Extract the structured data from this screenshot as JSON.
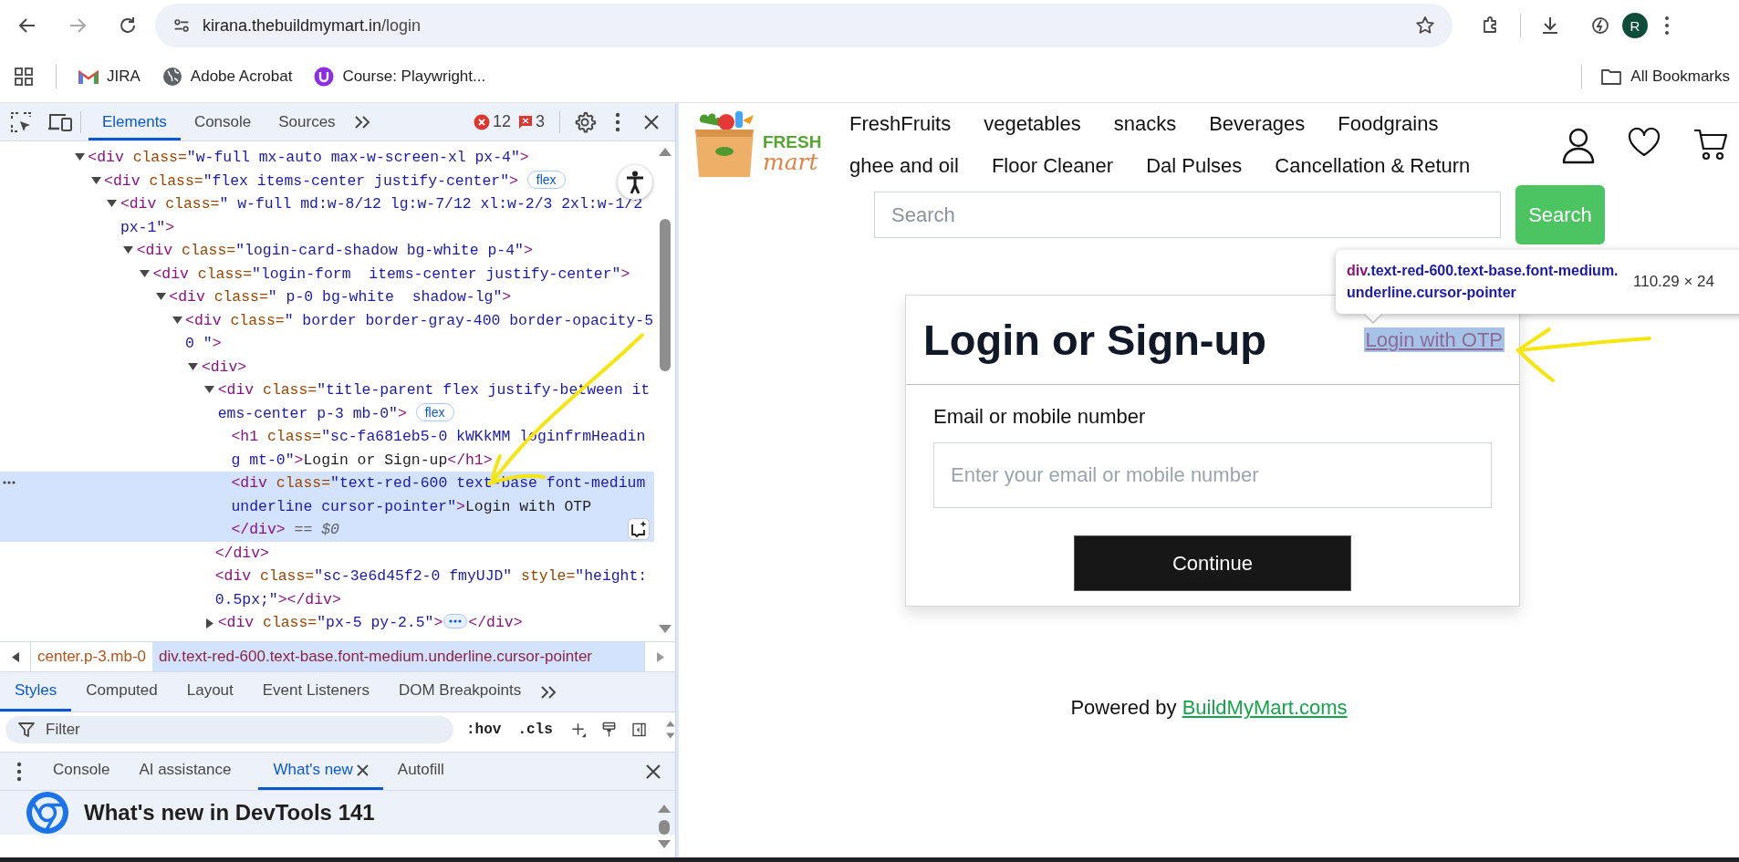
{
  "browser": {
    "url_host": "kirana.thebuildmymart.in",
    "url_path": "/login",
    "avatar": "R"
  },
  "bookmarks": [
    {
      "kind": "gmail",
      "label": "JIRA"
    },
    {
      "kind": "globe",
      "label": "Adobe Acrobat"
    },
    {
      "kind": "course",
      "label": "Course: Playwright..."
    }
  ],
  "all_bookmarks": "All Bookmarks",
  "devtools": {
    "tabs": [
      {
        "label": "Elements",
        "selected": true
      },
      {
        "label": "Console",
        "selected": false
      },
      {
        "label": "Sources",
        "selected": false
      }
    ],
    "errors": "12",
    "issues": "3",
    "dom_tree": [
      {
        "kind": "parent",
        "expanded": true,
        "selected": false,
        "tokens": [
          {
            "kind": "tag",
            "text": "<div"
          },
          {
            "kind": "attr",
            "text": " class="
          },
          {
            "kind": "value",
            "text": "\"w-full mx-auto max-w-screen-xl px-4\""
          },
          {
            "kind": "tag",
            "text": ">"
          }
        ],
        "children": [
          {
            "kind": "parent",
            "expanded": true,
            "selected": false,
            "badge": "flex",
            "tokens": [
              {
                "kind": "tag",
                "text": "<div"
              },
              {
                "kind": "attr",
                "text": " class="
              },
              {
                "kind": "value",
                "text": "\"flex items-center justify-center\""
              },
              {
                "kind": "tag",
                "text": ">"
              }
            ],
            "children": [
              {
                "kind": "parent",
                "expanded": true,
                "selected": false,
                "tokens": [
                  {
                    "kind": "tag",
                    "text": "<div"
                  },
                  {
                    "kind": "attr",
                    "text": " class="
                  },
                  {
                    "kind": "value",
                    "text": "\" w-full md:w-8/12 lg:w-7/12 xl:w-2/3 2xl:w-1/2 px-1\""
                  },
                  {
                    "kind": "tag",
                    "text": ">"
                  }
                ],
                "children": [
                  {
                    "kind": "parent",
                    "expanded": true,
                    "selected": false,
                    "tokens": [
                      {
                        "kind": "tag",
                        "text": "<div"
                      },
                      {
                        "kind": "attr",
                        "text": " class="
                      },
                      {
                        "kind": "value",
                        "text": "\"login-card-shadow bg-white p-4\""
                      },
                      {
                        "kind": "tag",
                        "text": ">"
                      }
                    ],
                    "children": [
                      {
                        "kind": "parent",
                        "expanded": true,
                        "selected": false,
                        "tokens": [
                          {
                            "kind": "tag",
                            "text": "<div"
                          },
                          {
                            "kind": "attr",
                            "text": " class="
                          },
                          {
                            "kind": "value",
                            "text": "\"login-form  items-center justify-center\""
                          },
                          {
                            "kind": "tag",
                            "text": ">"
                          }
                        ],
                        "children": [
                          {
                            "kind": "parent",
                            "expanded": true,
                            "selected": false,
                            "tokens": [
                              {
                                "kind": "tag",
                                "text": "<div"
                              },
                              {
                                "kind": "attr",
                                "text": " class="
                              },
                              {
                                "kind": "value",
                                "text": "\" p-0 bg-white  shadow-lg\""
                              },
                              {
                                "kind": "tag",
                                "text": ">"
                              }
                            ],
                            "children": [
                              {
                                "kind": "parent",
                                "expanded": true,
                                "selected": false,
                                "tokens": [
                                  {
                                    "kind": "tag",
                                    "text": "<div"
                                  },
                                  {
                                    "kind": "attr",
                                    "text": " class="
                                  },
                                  {
                                    "kind": "value",
                                    "text": "\" border border-gray-400 border-opacity-50 \""
                                  },
                                  {
                                    "kind": "tag",
                                    "text": ">"
                                  }
                                ],
                                "children": [
                                  {
                                    "kind": "parent",
                                    "expanded": true,
                                    "selected": false,
                                    "tokens": [
                                      {
                                        "kind": "tag",
                                        "text": "<div>"
                                      }
                                    ],
                                    "children": [
                                      {
                                        "kind": "parent",
                                        "expanded": true,
                                        "selected": false,
                                        "badge": "flex",
                                        "tokens": [
                                          {
                                            "kind": "tag",
                                            "text": "<div"
                                          },
                                          {
                                            "kind": "attr",
                                            "text": " class="
                                          },
                                          {
                                            "kind": "value",
                                            "text": "\"title-parent flex justify-between items-center p-3 mb-0\""
                                          },
                                          {
                                            "kind": "tag",
                                            "text": ">"
                                          }
                                        ],
                                        "close": [
                                          {
                                            "kind": "tag",
                                            "text": "</div>"
                                          }
                                        ],
                                        "children": [
                                          {
                                            "kind": "leaf",
                                            "selected": false,
                                            "tokens": [
                                              {
                                                "kind": "tag",
                                                "text": "<h1"
                                              },
                                              {
                                                "kind": "attr",
                                                "text": " class="
                                              },
                                              {
                                                "kind": "value",
                                                "text": "\"sc-fa681eb5-0 kWKkMM loginfrmHeading mt-0\""
                                              },
                                              {
                                                "kind": "tag",
                                                "text": ">"
                                              },
                                              {
                                                "kind": "text",
                                                "text": "Login or Sign-up"
                                              },
                                              {
                                                "kind": "tag",
                                                "text": "</h1>"
                                              }
                                            ]
                                          },
                                          {
                                            "kind": "leaf",
                                            "selected": true,
                                            "marker": "== $0",
                                            "tokens": [
                                              {
                                                "kind": "tag",
                                                "text": "<div"
                                              },
                                              {
                                                "kind": "attr",
                                                "text": " class="
                                              },
                                              {
                                                "kind": "value",
                                                "text": "\"text-red-600 text-base font-medium underline cursor-pointer\""
                                              },
                                              {
                                                "kind": "tag",
                                                "text": ">"
                                              },
                                              {
                                                "kind": "text",
                                                "text": "Login with OTP"
                                              }
                                            ],
                                            "close": [
                                              {
                                                "kind": "tag",
                                                "text": "</div>"
                                              }
                                            ]
                                          }
                                        ]
                                      },
                                      {
                                        "kind": "leaf",
                                        "selected": false,
                                        "tokens": [
                                          {
                                            "kind": "tag",
                                            "text": "<div"
                                          },
                                          {
                                            "kind": "attr",
                                            "text": " class="
                                          },
                                          {
                                            "kind": "value",
                                            "text": "\"sc-3e6d45f2-0 fmyUJD\""
                                          },
                                          {
                                            "kind": "attr",
                                            "text": " style="
                                          },
                                          {
                                            "kind": "value",
                                            "text": "\"height: 0.5px;\""
                                          },
                                          {
                                            "kind": "tag",
                                            "text": "></div>"
                                          }
                                        ]
                                      },
                                      {
                                        "kind": "parent",
                                        "expanded": false,
                                        "selected": false,
                                        "tokens": [
                                          {
                                            "kind": "tag",
                                            "text": "<div"
                                          },
                                          {
                                            "kind": "attr",
                                            "text": " class="
                                          },
                                          {
                                            "kind": "value",
                                            "text": "\"px-5 py-2.5\""
                                          },
                                          {
                                            "kind": "tag",
                                            "text": ">"
                                          }
                                        ],
                                        "close": [
                                          {
                                            "kind": "tag",
                                            "text": "</div>"
                                          }
                                        ]
                                      }
                                    ]
                                  }
                                ]
                              }
                            ]
                          }
                        ]
                      }
                    ]
                  }
                ]
              }
            ]
          }
        ]
      }
    ],
    "breadcrumbs": [
      {
        "label": "center.p-3.mb-0",
        "selected": false
      },
      {
        "label": "div.text-red-600.text-base.font-medium.underline.cursor-pointer",
        "selected": true
      }
    ],
    "styles_tabs": [
      {
        "label": "Styles",
        "selected": true
      },
      {
        "label": "Computed",
        "selected": false
      },
      {
        "label": "Layout",
        "selected": false
      },
      {
        "label": "Event Listeners",
        "selected": false
      },
      {
        "label": "DOM Breakpoints",
        "selected": false
      }
    ],
    "filter": {
      "placeholder": "Filter"
    },
    "filter_buttons": [
      ":hov",
      ".cls"
    ],
    "drawer_tabs": [
      {
        "label": "Console",
        "selected": false,
        "closable": false
      },
      {
        "label": "AI assistance",
        "selected": false,
        "closable": false
      },
      {
        "label": "What's new",
        "selected": true,
        "closable": true
      },
      {
        "label": "Autofill",
        "selected": false,
        "closable": false
      }
    ],
    "whats_new_title": "What's new in DevTools 141"
  },
  "page": {
    "logo": {
      "line_1": "FRESH",
      "line_2": "mart"
    },
    "nav": [
      "FreshFruits",
      "vegetables",
      "snacks",
      "Beverages",
      "Foodgrains",
      "ghee and oil",
      "Floor Cleaner",
      "Dal Pulses",
      "Cancellation & Return"
    ],
    "search": {
      "placeholder": "Search",
      "button": "Search"
    },
    "inspect_tooltip": {
      "tag": "div",
      "classes": ".text-red-600.text-base.font-medium.underline.cursor-pointer",
      "size": "110.29 × 24"
    },
    "login_card": {
      "title": "Login or Sign-up",
      "otp_link": "Login with OTP",
      "otp_highlighted": true,
      "field_label": "Email or mobile number",
      "field_placeholder": "Enter your email or mobile number",
      "button": "Continue"
    },
    "footer": {
      "text": "Powered by",
      "link": "BuildMyMart.coms"
    }
  }
}
